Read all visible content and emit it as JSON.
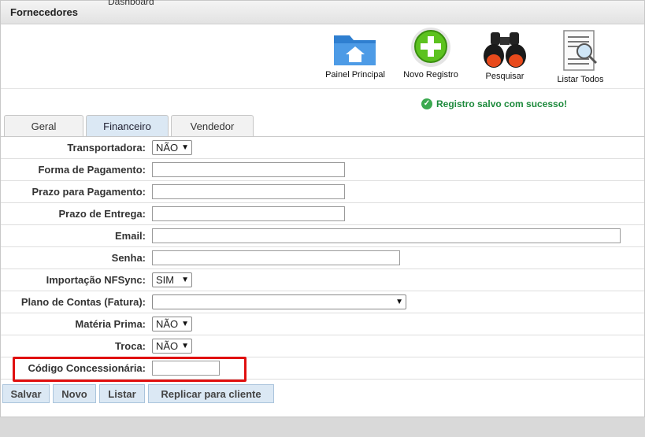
{
  "window": {
    "title": "Fornecedores",
    "ghost_text": "Dashboard"
  },
  "toolbar": {
    "painel": "Painel Principal",
    "novo": "Novo Registro",
    "pesquisar": "Pesquisar",
    "listar": "Listar Todos"
  },
  "status": {
    "message": "Registro salvo com sucesso!"
  },
  "tabs": {
    "geral": "Geral",
    "financeiro": "Financeiro",
    "vendedor": "Vendedor"
  },
  "form": {
    "transportadora": {
      "label": "Transportadora:",
      "value": "NÃO"
    },
    "forma_pagamento": {
      "label": "Forma de Pagamento:",
      "value": ""
    },
    "prazo_pagamento": {
      "label": "Prazo para Pagamento:",
      "value": ""
    },
    "prazo_entrega": {
      "label": "Prazo de Entrega:",
      "value": ""
    },
    "email": {
      "label": "Email:",
      "value": ""
    },
    "senha": {
      "label": "Senha:",
      "value": ""
    },
    "importacao": {
      "label": "Importação NFSync:",
      "value": "SIM"
    },
    "plano_contas": {
      "label": "Plano de Contas (Fatura):",
      "value": ""
    },
    "materia_prima": {
      "label": "Matéria Prima:",
      "value": "NÃO"
    },
    "troca": {
      "label": "Troca:",
      "value": "NÃO"
    },
    "codigo_concessionaria": {
      "label": "Código Concessionária:",
      "value": ""
    }
  },
  "actions": {
    "salvar": "Salvar",
    "novo": "Novo",
    "listar": "Listar",
    "replicar": "Replicar para cliente"
  },
  "colors": {
    "accent_tab": "#dbe8f4",
    "success": "#1d8a3c",
    "highlight": "#e01010"
  }
}
